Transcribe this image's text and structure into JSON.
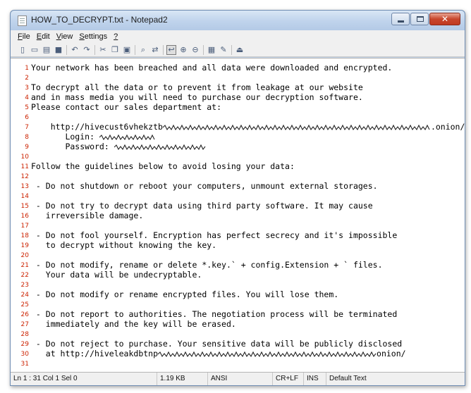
{
  "window": {
    "title": "HOW_TO_DECRYPT.txt - Notepad2"
  },
  "menu": [
    {
      "key": "F",
      "rest": "ile"
    },
    {
      "key": "E",
      "rest": "dit"
    },
    {
      "key": "V",
      "rest": "iew"
    },
    {
      "key": "S",
      "rest": "ettings"
    },
    {
      "key": "?",
      "rest": ""
    }
  ],
  "toolbar": [
    "new-file-icon",
    "open-icon",
    "browse-icon",
    "save-icon",
    "undo-icon",
    "redo-icon",
    "cut-icon",
    "copy-icon",
    "paste-icon",
    "find-icon",
    "replace-icon",
    "word-wrap-icon",
    "zoom-in-icon",
    "zoom-out-icon",
    "scheme-icon",
    "customize-icon",
    "exit-icon"
  ],
  "lines": [
    "Your network has been breached and all data were downloaded and encrypted.",
    "",
    "To decrypt all the data or to prevent it from leakage at our website",
    "and in mass media you will need to purchase our decryption software.",
    "Please contact our sales department at:",
    "",
    "    http://hivecust6vhekztb",
    "       Login: ",
    "       Password: ",
    "",
    "Follow the guidelines below to avoid losing your data:",
    "",
    " - Do not shutdown or reboot your computers, unmount external storages.",
    "",
    " - Do not try to decrypt data using third party software. It may cause",
    "   irreversible damage.",
    "",
    " - Do not fool yourself. Encryption has perfect secrecy and it's impossible",
    "   to decrypt without knowing the key.",
    "",
    " - Do not modify, rename or delete *.key.` + config.Extension + ` files.",
    "   Your data will be undecryptable.",
    "",
    " - Do not modify or rename encrypted files. You will lose them.",
    "",
    " - Do not report to authorities. The negotiation process will be terminated",
    "   immediately and the key will be erased.",
    "",
    " - Do not reject to purchase. Your sensitive data will be publicly disclosed",
    "   at http://hiveleakdbtnp",
    ""
  ],
  "line_suffixes": {
    "7": ".onion/",
    "30": "onion/"
  },
  "status": {
    "position": "Ln 1 : 31  Col 1  Sel 0",
    "size": "1.19 KB",
    "encoding": "ANSI",
    "eol": "CR+LF",
    "ins": "INS",
    "scheme": "Default Text"
  }
}
